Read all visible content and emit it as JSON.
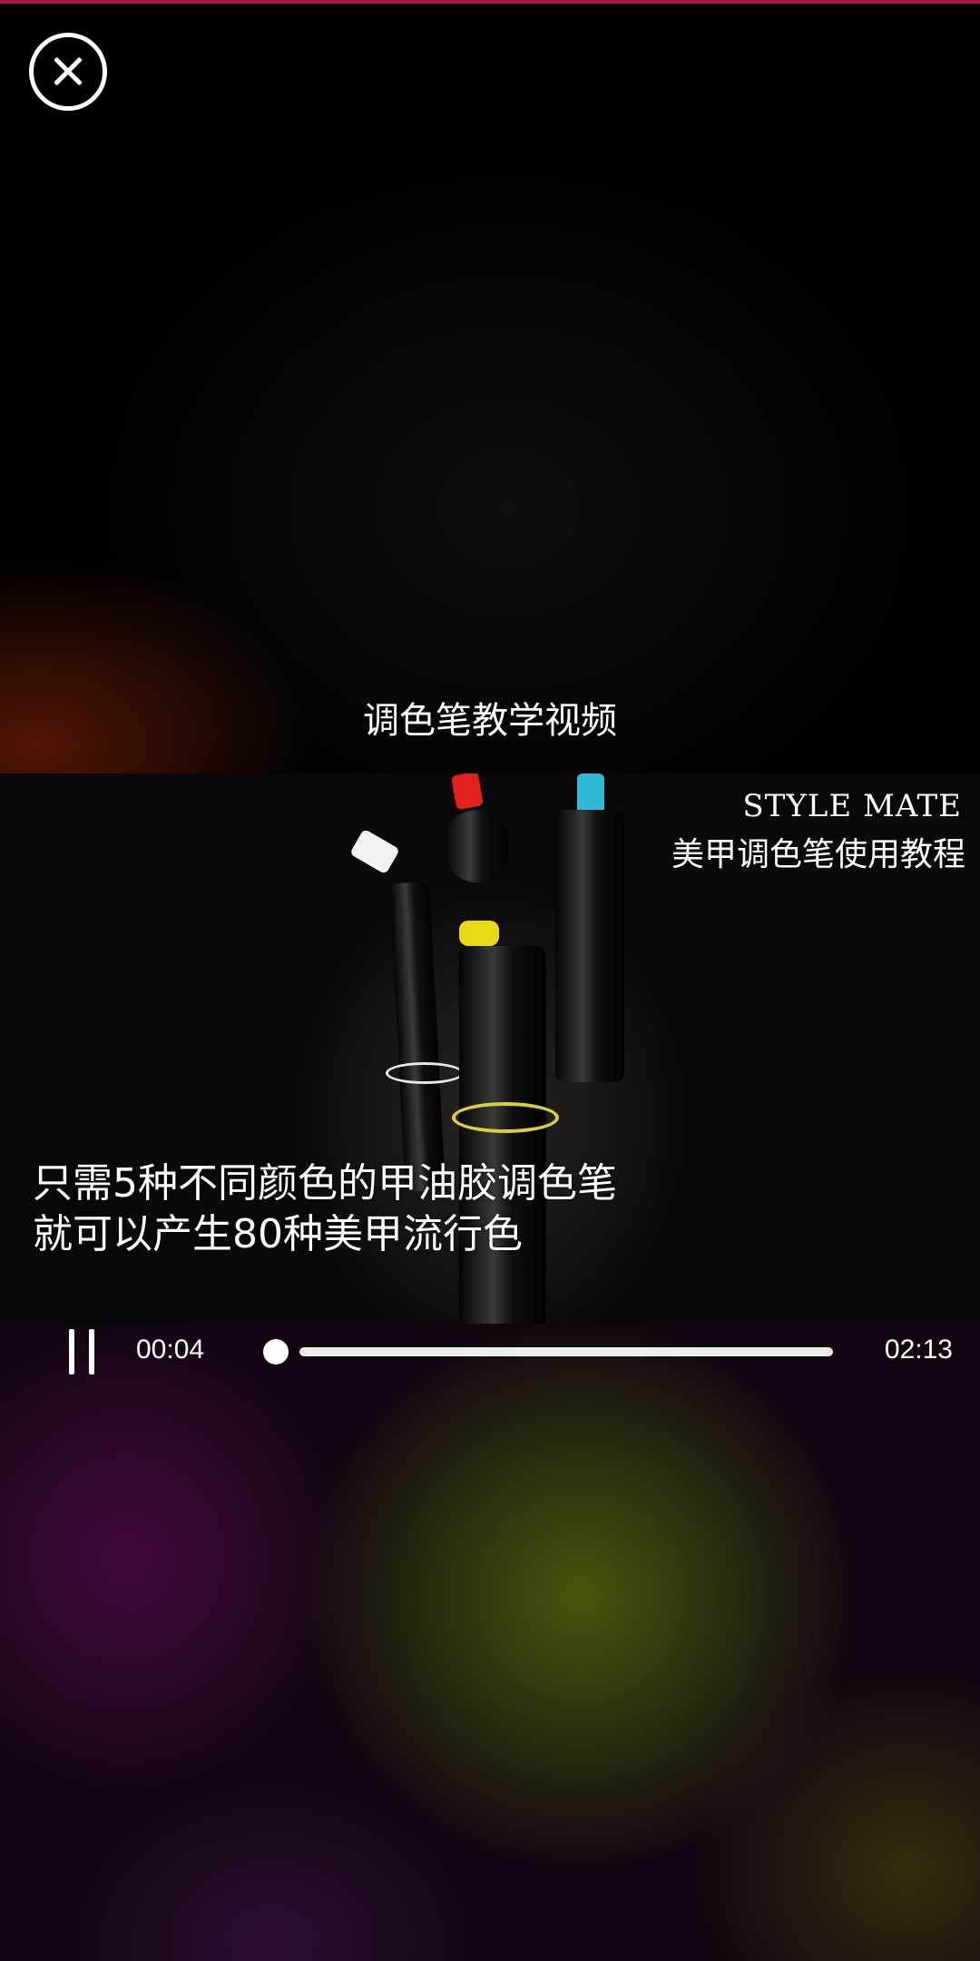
{
  "window": {
    "close_icon": "close-icon"
  },
  "video": {
    "title": "调色笔教学视频",
    "brand": "STYLE MATE",
    "subtitle": "美甲调色笔使用教程",
    "caption_line_1": "只需5种不同颜色的甲油胶调色笔",
    "caption_line_2": "就可以产生80种美甲流行色",
    "pen_cap_colors": [
      "#f2f2f2",
      "#e0201e",
      "#2fb8d8",
      "#e8d818"
    ]
  },
  "player": {
    "state": "playing",
    "pause_icon": "pause-icon",
    "current_time": "00:04",
    "total_time": "02:13",
    "progress_fraction": 0.03
  },
  "colors": {
    "accent": "#b0124a"
  }
}
